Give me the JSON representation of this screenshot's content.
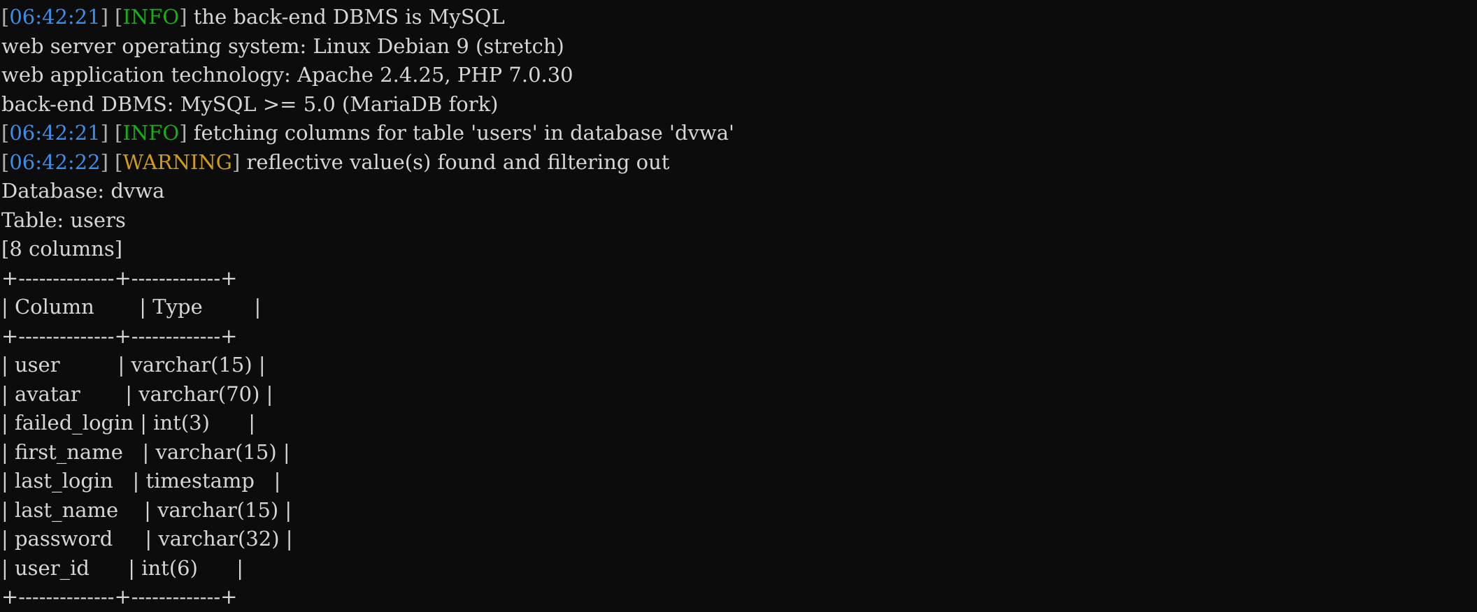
{
  "terminal": {
    "app": "sqlmap-terminal-output",
    "background_color": "#0c0c0c",
    "foreground_color": "#d6d6d6",
    "colors": {
      "timestamp": "#3b8eea",
      "info": "#14b014",
      "warning": "#cf9c19",
      "bracket": "#b0b0b0",
      "text": "#d6d6d6"
    },
    "log_lines": [
      {
        "timestamp": "06:42:21",
        "level": "INFO",
        "level_color": "#14b014",
        "message": "the back-end DBMS is MySQL"
      },
      {
        "timestamp": "",
        "level": "",
        "level_color": "",
        "message": "web server operating system: Linux Debian 9 (stretch)"
      },
      {
        "timestamp": "",
        "level": "",
        "level_color": "",
        "message": "web application technology: Apache 2.4.25, PHP 7.0.30"
      },
      {
        "timestamp": "",
        "level": "",
        "level_color": "",
        "message": "back-end DBMS: MySQL >= 5.0 (MariaDB fork)"
      },
      {
        "timestamp": "06:42:21",
        "level": "INFO",
        "level_color": "#14b014",
        "message": "fetching columns for table 'users' in database 'dvwa'"
      },
      {
        "timestamp": "06:42:22",
        "level": "WARNING",
        "level_color": "#cf9c19",
        "message": "reflective value(s) found and filtering out"
      }
    ],
    "database_label": "Database: dvwa",
    "table_label": "Table: users",
    "column_count_label": "[8 columns]",
    "result_table": {
      "border_top": "+--------------+-------------+",
      "border_mid": "+--------------+-------------+",
      "border_bottom": "+--------------+-------------+",
      "headers": [
        "Column",
        "Type"
      ],
      "header_row": "| Column       | Type        |",
      "rows": [
        {
          "column": "user",
          "type": "varchar(15)"
        },
        {
          "column": "avatar",
          "type": "varchar(70)"
        },
        {
          "column": "failed_login",
          "type": "int(3)"
        },
        {
          "column": "first_name",
          "type": "varchar(15)"
        },
        {
          "column": "last_login",
          "type": "timestamp"
        },
        {
          "column": "last_name",
          "type": "varchar(15)"
        },
        {
          "column": "password",
          "type": "varchar(32)"
        },
        {
          "column": "user_id",
          "type": "int(6)"
        }
      ]
    }
  }
}
